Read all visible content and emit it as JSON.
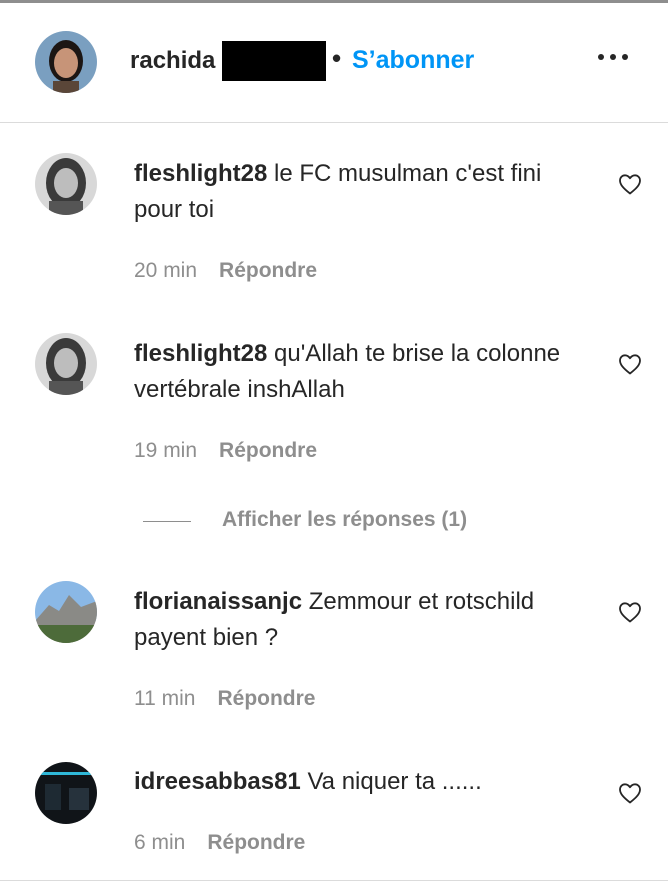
{
  "header": {
    "username": "rachida",
    "separator": "•",
    "follow_label": "S’abonner",
    "more_icon": "more-options-icon"
  },
  "comments": [
    {
      "username": "fleshlight28",
      "text": "le FC musulman c'est fini pour toi",
      "time": "20 min",
      "reply_label": "Répondre"
    },
    {
      "username": "fleshlight28",
      "text": "qu'Allah te brise la colonne vertébrale inshAllah",
      "time": "19 min",
      "reply_label": "Répondre"
    },
    {
      "username": "florianaissanjc",
      "text": "Zemmour et rotschild payent bien ?",
      "time": "11 min",
      "reply_label": "Répondre"
    },
    {
      "username": "idreesabbas81",
      "text": "Va niquer ta ......",
      "time": "6 min",
      "reply_label": "Répondre"
    }
  ],
  "replies_toggle": {
    "label": "Afficher les réponses (1)"
  },
  "colors": {
    "accent": "#0095f6",
    "text": "#262626",
    "muted": "#8e8e8e",
    "divider": "#dbdbdb"
  }
}
